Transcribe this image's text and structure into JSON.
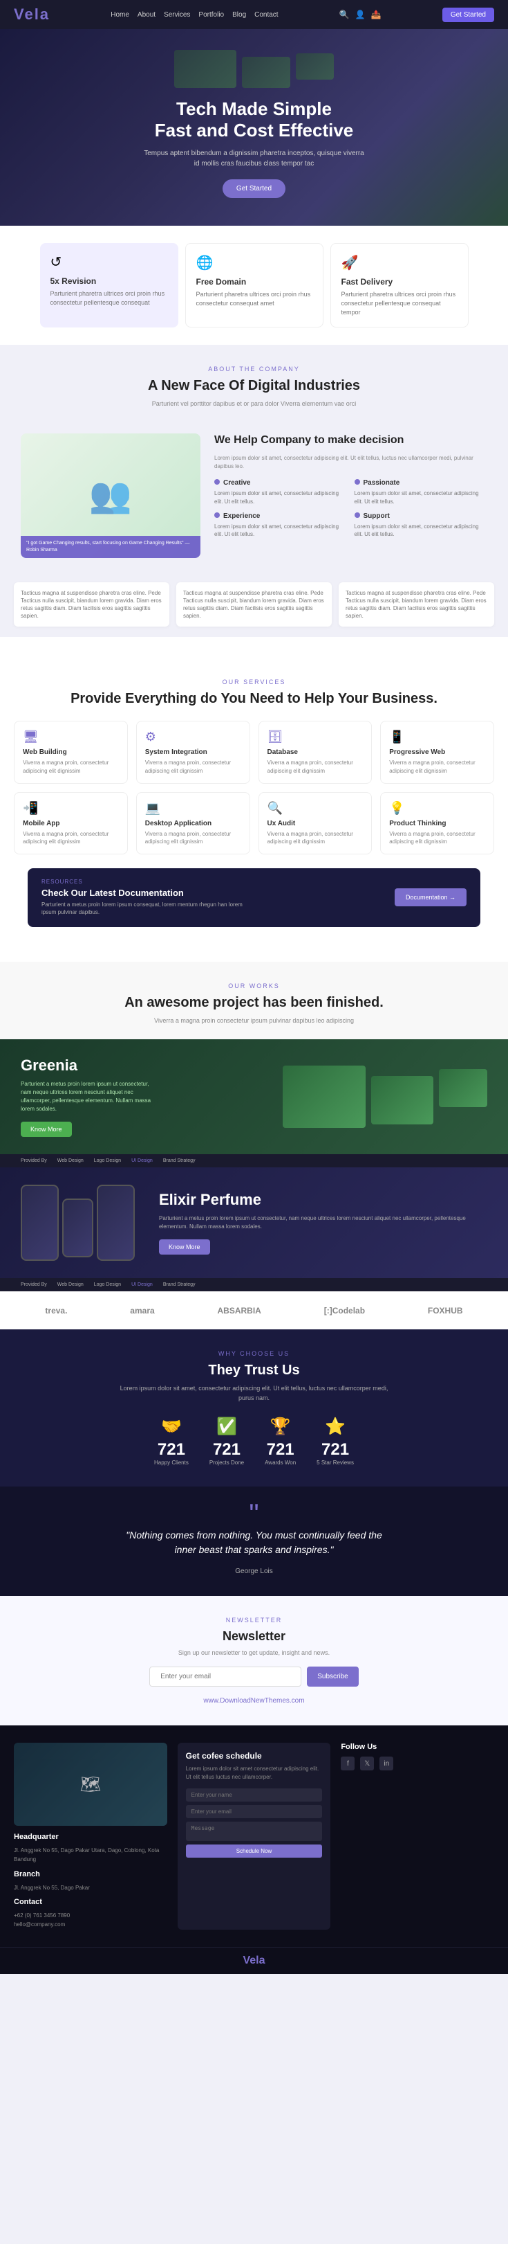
{
  "brand": {
    "name": "Vela",
    "logo_text": "Vela"
  },
  "navbar": {
    "links": [
      "Home",
      "About",
      "Services",
      "Portfolio",
      "Blog",
      "Contact"
    ],
    "btn_label": "Get Started"
  },
  "hero": {
    "title": "Tech Made Simple\nFast and Cost Effective",
    "description": "Tempus aptent bibendum a dignissim pharetra inceptos, quisque viverra id mollis cras faucibus class tempor tac",
    "btn_label": "Get Started"
  },
  "features": [
    {
      "icon": "↺",
      "title": "5x Revision",
      "desc": "Parturient pharetra ultrices orci proin rhus consectetur pellentesque consequat",
      "style": "purple"
    },
    {
      "icon": "🌐",
      "title": "Free Domain",
      "desc": "Parturient pharetra ultrices orci proin rhus consectetur consequat amet",
      "style": "white"
    },
    {
      "icon": "🚀",
      "title": "Fast Delivery",
      "desc": "Parturient pharetra ultrices orci proin rhus consectetur pellentesque consequat tempor",
      "style": "white"
    }
  ],
  "about": {
    "tag": "ABOUT THE COMPANY",
    "section_title": "A New Face Of Digital Industries",
    "section_desc": "Parturient vel porttitor dapibus et or para dolor Viverra elementum vae orci",
    "quote": "\"I got Game Changing results, start focusing on Game Changing Results\" — Robin Sharma",
    "heading": "We Help Company to make decision",
    "heading_desc": "Lorem ipsum dolor sit amet, consectetur adipiscing elit. Ut elit tellus, luctus nec ullamcorper medi, pulvinar dapibus leo.",
    "items": [
      {
        "title": "Creative",
        "desc": "Lorem ipsum dolor sit amet, consectetur adipiscing elit. Ut elit tellus."
      },
      {
        "title": "Passionate",
        "desc": "Lorem ipsum dolor sit amet, consectetur adipiscing elit. Ut elit tellus."
      },
      {
        "title": "Experience",
        "desc": "Lorem ipsum dolor sit amet, consectetur adipiscing elit. Ut elit tellus."
      },
      {
        "title": "Support",
        "desc": "Lorem ipsum dolor sit amet, consectetur adipiscing elit. Ut elit tellus."
      }
    ]
  },
  "testimonials": [
    "Tacticus magna at suspendisse pharetra cras eline. Pede Tacticus nulla suscipit, biandum lorem gravida. Diam eros retus sagittis diam. Diam facilisis eros sagittis sagittis sapien.",
    "Tacticus magna at suspendisse pharetra cras eline. Pede Tacticus nulla suscipit, biandum lorem gravida. Diam eros retus sagittis diam. Diam facilisis eros sagittis sagittis sapien.",
    "Tacticus magna at suspendisse pharetra cras eline. Pede Tacticus nulla suscipit, biandum lorem gravida. Diam eros retus sagittis diam. Diam facilisis eros sagittis sagittis sapien."
  ],
  "services": {
    "tag": "OUR SERVICES",
    "title": "Provide Everything do You Need to Help Your Business.",
    "items": [
      {
        "icon": "🖥",
        "title": "Web Building",
        "desc": "Viverra a magna proin, consectetur adipiscing elit dignissim"
      },
      {
        "icon": "⚙",
        "title": "System Integration",
        "desc": "Viverra a magna proin, consectetur adipiscing elit dignissim"
      },
      {
        "icon": "🗄",
        "title": "Database",
        "desc": "Viverra a magna proin, consectetur adipiscing elit dignissim"
      },
      {
        "icon": "📱",
        "title": "Progressive Web",
        "desc": "Viverra a magna proin, consectetur adipiscing elit dignissim"
      },
      {
        "icon": "📲",
        "title": "Mobile App",
        "desc": "Viverra a magna proin, consectetur adipiscing elit dignissim"
      },
      {
        "icon": "💻",
        "title": "Desktop Application",
        "desc": "Viverra a magna proin, consectetur adipiscing elit dignissim"
      },
      {
        "icon": "🔍",
        "title": "Ux Audit",
        "desc": "Viverra a magna proin, consectetur adipiscing elit dignissim"
      },
      {
        "icon": "💡",
        "title": "Product Thinking",
        "desc": "Viverra a magna proin, consectetur adipiscing elit dignissim"
      }
    ],
    "doc_banner": {
      "tag": "RESOURCES",
      "title": "Check Our Latest Documentation",
      "desc": "Parturient a metus proin lorem ipsum consequat, lorem mentum rhegun han lorem ipsum pulvinar dapibus.",
      "btn_label": "Documentation →"
    }
  },
  "portfolio": {
    "tag": "OUR WORKS",
    "title": "An awesome project has been finished.",
    "desc": "Viverra a magna proin consectetur ipsum pulvinar dapibus leo adipiscing",
    "projects": [
      {
        "title": "Greenia",
        "desc": "Parturient a metus proin lorem ipsum ut consectetur, nam neque ultrices lorem nesciunt aliquet nec ullamcorper, pellentesque elementum. Nullam massa lorem sodales.",
        "btn_label": "Know More",
        "tags": [
          "Web Design",
          "Logo Design",
          "UI Design",
          "Brand Strategy"
        ]
      },
      {
        "title": "Elixir Perfume",
        "desc": "Parturient a metus proin lorem ipsum ut consectetur, nam neque ultrices lorem nesciunt aliquet nec ullamcorper, pellentesque elementum. Nullam massa lorem sodales.",
        "btn_label": "Know More",
        "tags": [
          "Web Design",
          "Logo Design",
          "UI Design",
          "Brand Strategy"
        ]
      }
    ]
  },
  "clients": [
    "treva.",
    "amara",
    "ABSARBIA",
    "[:]Codelab",
    "FOXHUB"
  ],
  "trust": {
    "tag": "WHY CHOOSE US",
    "title": "They Trust Us",
    "desc": "Lorem ipsum dolor sit amet, consectetur adipiscing elit. Ut elit tellus, luctus nec ullamcorper medi, purus nam.",
    "stats": [
      {
        "icon": "🤝",
        "number": "721",
        "label": "Happy Clients"
      },
      {
        "icon": "✅",
        "number": "721",
        "label": "Projects Done"
      },
      {
        "icon": "🏆",
        "number": "721",
        "label": "Awards Won"
      },
      {
        "icon": "⭐",
        "number": "721",
        "label": "5 Star Reviews"
      }
    ]
  },
  "quote": {
    "text": "\"Nothing comes from nothing. You must continually feed the inner beast that sparks and inspires.\"",
    "author": "George Lois"
  },
  "newsletter": {
    "tag": "NEWSLETTER",
    "title": "Newsletter",
    "desc": "Sign up our newsletter to get update, insight and news.",
    "input_placeholder": "Enter your email",
    "btn_label": "Subscribe",
    "website_url": "www.DownloadNewThemes.com"
  },
  "footer": {
    "headquarter": {
      "label": "Headquarter",
      "address": "Jl. Anggrek No 55, Dago Pakar Utara, Dago, Coblong, Kota Bandung"
    },
    "branch": {
      "label": "Branch",
      "address": "Jl. Anggrek No 55, Dago Pakar"
    },
    "contact": {
      "label": "Contact",
      "phone": "+62 (0) 761 3456 7890",
      "email": "hello@company.com"
    },
    "schedule": {
      "title": "Get cofee schedule",
      "desc": "Lorem ipsum dolor sit amet consectetur adipiscing elit. Ut elit tellus luctus nec ullamcorper.",
      "input_placeholder": "Enter your name",
      "btn_label": "Schedule Now"
    },
    "social": {
      "label": "Follow Us",
      "icons": [
        "f",
        "𝕏",
        "in"
      ]
    },
    "bottom_logo": "Vela"
  }
}
